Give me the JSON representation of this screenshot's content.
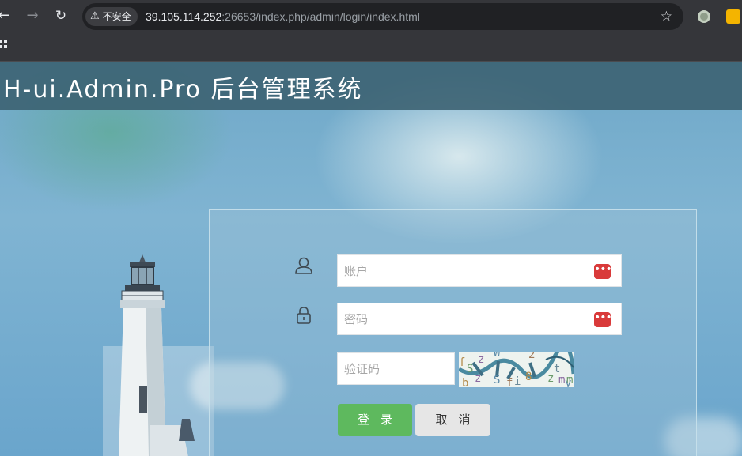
{
  "browser": {
    "security_label": "不安全",
    "url_host": "39.105.114.252",
    "url_rest": ":26653/index.php/admin/login/index.html"
  },
  "header": {
    "brand": "H-ui.Admin.Pro 后台管理系统"
  },
  "login": {
    "account_placeholder": "账户",
    "password_placeholder": "密码",
    "captcha_placeholder": "验证码",
    "captcha_glyphs": [
      "f",
      "S",
      "z",
      "W",
      "2",
      "t",
      "b",
      "m",
      "z",
      "S",
      "f",
      "i",
      "8",
      "z",
      "m",
      "y"
    ],
    "login_label": "登录",
    "cancel_label": "取消"
  },
  "colors": {
    "header_bg": "#3a6070",
    "login_button": "#5eb95e",
    "cancel_button": "#e6e6e6",
    "password_key_icon": "#d93a3a"
  }
}
